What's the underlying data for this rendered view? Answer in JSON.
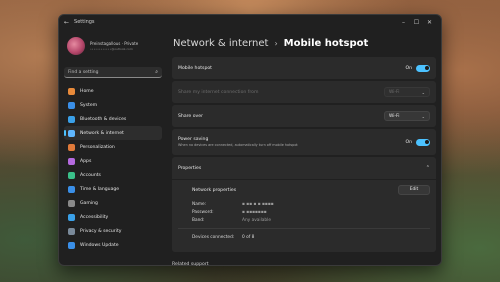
{
  "window": {
    "title": "Settings"
  },
  "titlebar": {
    "back": "←",
    "minimize": "–",
    "maximize": "☐",
    "close": "✕"
  },
  "profile": {
    "name": "Preinstagallous · Private",
    "email": "••••••••••••@outlook.com"
  },
  "search": {
    "placeholder": "Find a setting",
    "icon": "search-icon"
  },
  "nav": [
    {
      "label": "Home",
      "color": "#e88a3a"
    },
    {
      "label": "System",
      "color": "#3a8fe8"
    },
    {
      "label": "Bluetooth & devices",
      "color": "#3aa0e8"
    },
    {
      "label": "Network & internet",
      "color": "#5fb7ff"
    },
    {
      "label": "Personalization",
      "color": "#e07a3a"
    },
    {
      "label": "Apps",
      "color": "#b56ae0"
    },
    {
      "label": "Accounts",
      "color": "#3ac08a"
    },
    {
      "label": "Time & language",
      "color": "#3a8fe8"
    },
    {
      "label": "Gaming",
      "color": "#8a8a8a"
    },
    {
      "label": "Accessibility",
      "color": "#3aa0e8"
    },
    {
      "label": "Privacy & security",
      "color": "#7a8a9a"
    },
    {
      "label": "Windows Update",
      "color": "#3a8fe8"
    }
  ],
  "active_nav_index": 3,
  "breadcrumb": {
    "parent": "Network & internet",
    "separator": "›",
    "current": "Mobile hotspot"
  },
  "hotspot": {
    "label": "Mobile hotspot",
    "state": "On"
  },
  "share_from": {
    "label": "Share my internet connection from",
    "value": "Wi-Fi"
  },
  "share_over": {
    "label": "Share over",
    "value": "Wi-Fi"
  },
  "power_saving": {
    "label": "Power saving",
    "description": "When no devices are connected, automatically turn off mobile hotspot",
    "state": "On"
  },
  "properties": {
    "label": "Properties",
    "network_properties": "Network properties",
    "edit": "Edit",
    "name_key": "Name:",
    "name_val": "▪ ▪▪ ▪ ▪ ▪▪▪▪",
    "password_key": "Password:",
    "password_val": "▪ ▪▪▪▪▪▪▪",
    "band_key": "Band:",
    "band_val": "Any available",
    "devices_key": "Devices connected:",
    "devices_val": "0 of 8"
  },
  "related": {
    "label": "Related support"
  }
}
